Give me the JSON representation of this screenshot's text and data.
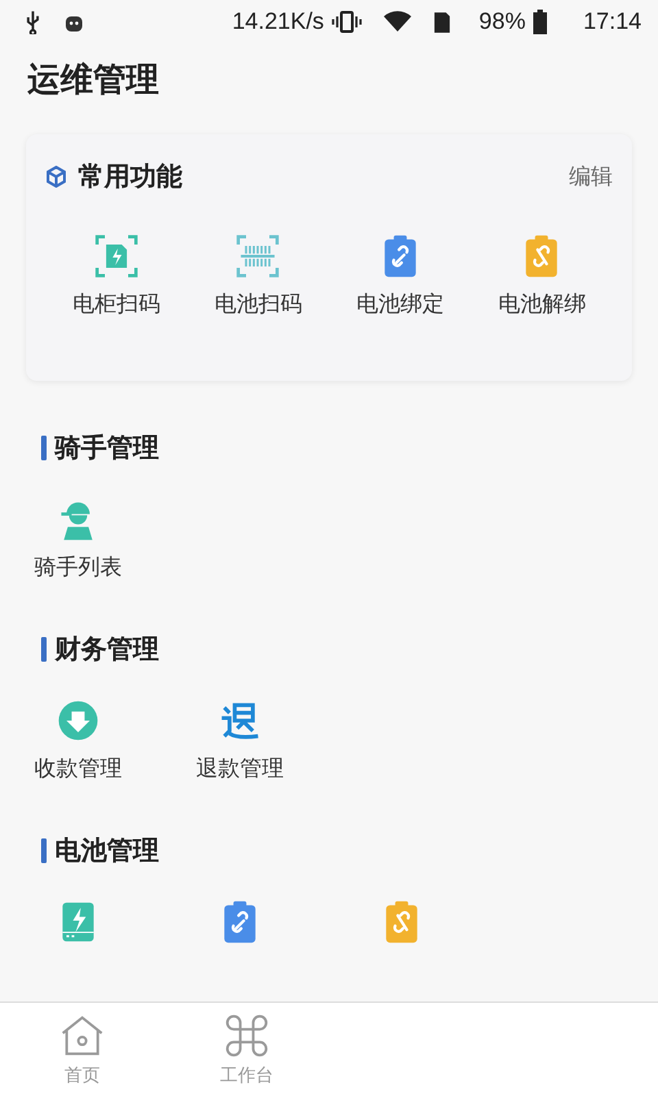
{
  "status_bar": {
    "speed": "14.21K/s",
    "battery": "98%",
    "time": "17:14"
  },
  "page_title": "运维管理",
  "favorites": {
    "title": "常用功能",
    "edit": "编辑",
    "items": [
      {
        "label": "电柜扫码",
        "kind": "cabinet-scan"
      },
      {
        "label": "电池扫码",
        "kind": "barcode-scan"
      },
      {
        "label": "电池绑定",
        "kind": "bind"
      },
      {
        "label": "电池解绑",
        "kind": "unbind"
      }
    ]
  },
  "sections": [
    {
      "title": "骑手管理",
      "items": [
        {
          "label": "骑手列表",
          "kind": "rider"
        }
      ]
    },
    {
      "title": "财务管理",
      "items": [
        {
          "label": "收款管理",
          "kind": "receive"
        },
        {
          "label": "退款管理",
          "kind": "refund"
        }
      ]
    },
    {
      "title": "电池管理",
      "items": [
        {
          "kind": "battery"
        },
        {
          "kind": "bind"
        },
        {
          "kind": "unbind"
        }
      ]
    }
  ],
  "bottom_nav": [
    {
      "label": "首页",
      "kind": "home",
      "selected": false
    },
    {
      "label": "工作台",
      "kind": "workbench",
      "selected": false
    }
  ]
}
